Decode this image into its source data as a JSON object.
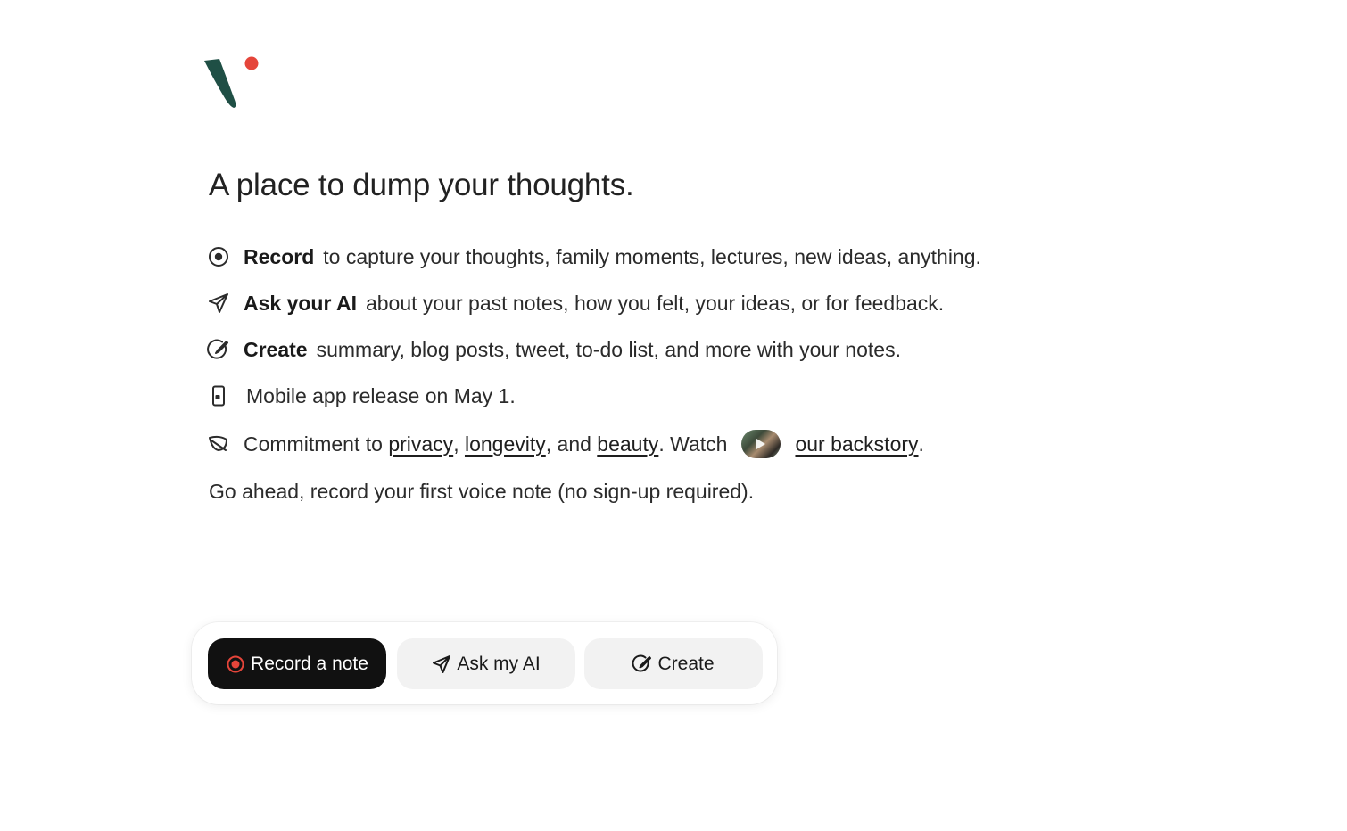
{
  "brand": {
    "accent": "#e5453a",
    "logo_color": "#1f4f45"
  },
  "headline": "A place to dump your thoughts.",
  "features": [
    {
      "icon": "record-icon",
      "bold": "Record",
      "text": "to capture your thoughts, family moments, lectures, new ideas, anything."
    },
    {
      "icon": "send-icon",
      "bold": "Ask your AI",
      "text": "about your past notes, how you felt, your ideas, or for feedback."
    },
    {
      "icon": "create-icon",
      "bold": "Create",
      "text": "summary, blog posts, tweet, to-do list, and more with your notes."
    },
    {
      "icon": "mobile-icon",
      "text": "Mobile app release on May 1."
    }
  ],
  "commitment": {
    "icon": "leaf-icon",
    "prefix": "Commitment to",
    "link_privacy": "privacy",
    "comma1": ",",
    "link_longevity": "longevity",
    "and": ", and",
    "link_beauty": "beauty",
    "watch": ". Watch",
    "thumb_icon": "video-thumbnail",
    "link_backstory": "our backstory",
    "period": "."
  },
  "subtitle": "Go ahead, record your first voice note (no sign-up required).",
  "actions": {
    "record_label": "Record a note",
    "ask_label": "Ask my AI",
    "create_label": "Create"
  }
}
